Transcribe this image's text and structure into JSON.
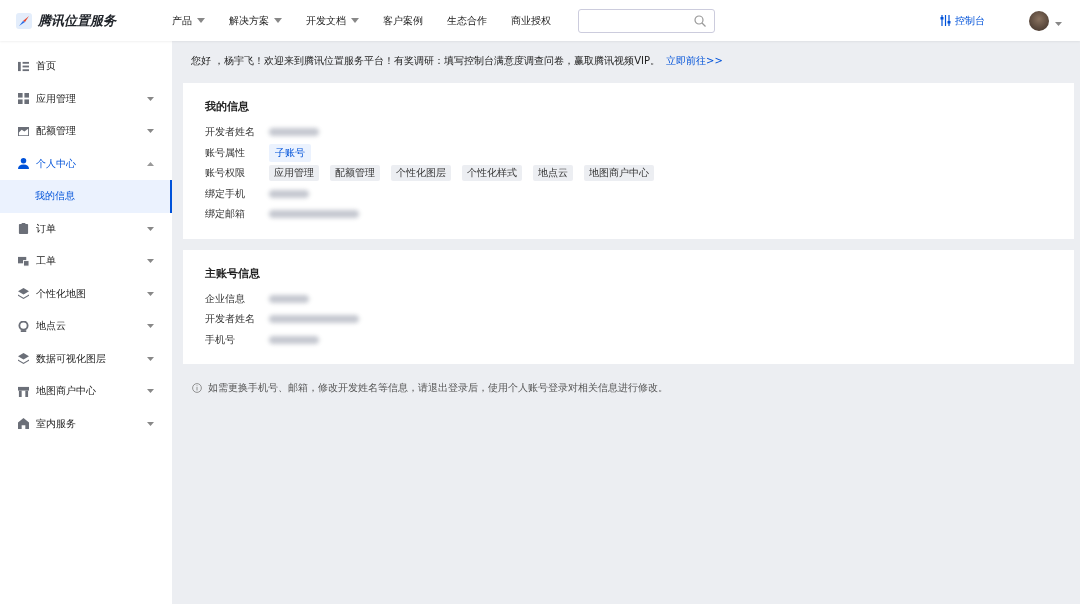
{
  "header": {
    "logo": "腾讯位置服务",
    "nav": [
      {
        "label": "产品",
        "dropdown": true
      },
      {
        "label": "解决方案",
        "dropdown": true
      },
      {
        "label": "开发文档",
        "dropdown": true
      },
      {
        "label": "客户案例",
        "dropdown": false
      },
      {
        "label": "生态合作",
        "dropdown": false
      },
      {
        "label": "商业授权",
        "dropdown": false
      }
    ],
    "console": "控制台"
  },
  "sidebar": {
    "items": [
      {
        "label": "首页",
        "expanded": false,
        "has_caret": false
      },
      {
        "label": "应用管理",
        "expanded": false,
        "has_caret": true
      },
      {
        "label": "配额管理",
        "expanded": false,
        "has_caret": true
      },
      {
        "label": "个人中心",
        "expanded": true,
        "has_caret": true,
        "children": [
          {
            "label": "我的信息",
            "selected": true
          }
        ]
      },
      {
        "label": "订单",
        "expanded": false,
        "has_caret": true
      },
      {
        "label": "工单",
        "expanded": false,
        "has_caret": true
      },
      {
        "label": "个性化地图",
        "expanded": false,
        "has_caret": true
      },
      {
        "label": "地点云",
        "expanded": false,
        "has_caret": true
      },
      {
        "label": "数据可视化图层",
        "expanded": false,
        "has_caret": true
      },
      {
        "label": "地图商户中心",
        "expanded": false,
        "has_caret": true
      },
      {
        "label": "室内服务",
        "expanded": false,
        "has_caret": true
      }
    ]
  },
  "notice": {
    "text": "您好 ，杨宇飞！欢迎来到腾讯位置服务平台！有奖调研：填写控制台满意度调查问卷，赢取腾讯视频VIP。",
    "link": "立即前往>>"
  },
  "cards": [
    {
      "title": "我的信息",
      "rows": [
        {
          "label": "开发者姓名",
          "kind": "blurred"
        },
        {
          "label": "账号属性",
          "kind": "badge",
          "badge": "子账号"
        },
        {
          "label": "账号权限",
          "kind": "tags",
          "tags": [
            "应用管理",
            "配额管理",
            "个性化图层",
            "个性化样式",
            "地点云",
            "地图商户中心"
          ]
        },
        {
          "label": "绑定手机",
          "kind": "blurred"
        },
        {
          "label": "绑定邮箱",
          "kind": "blurred"
        }
      ]
    },
    {
      "title": "主账号信息",
      "rows": [
        {
          "label": "企业信息",
          "kind": "blurred"
        },
        {
          "label": "开发者姓名",
          "kind": "blurred"
        },
        {
          "label": "手机号",
          "kind": "blurred"
        }
      ]
    }
  ],
  "footnote": "如需更换手机号、邮箱，修改开发姓名等信息，请退出登录后，使用个人账号登录对相关信息进行修改。"
}
